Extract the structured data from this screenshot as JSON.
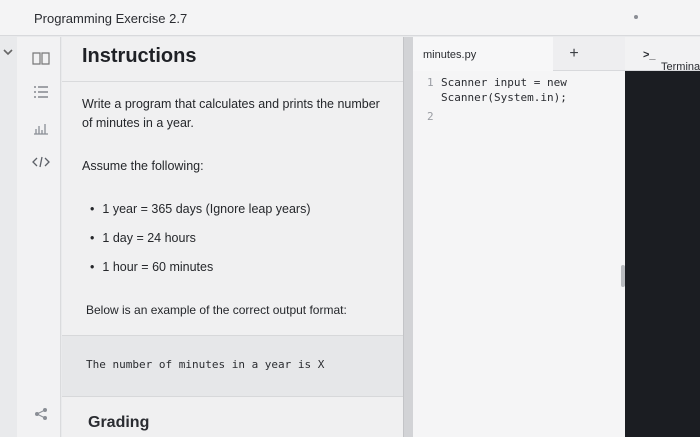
{
  "window": {
    "title": "Programming Exercise 2.7"
  },
  "rail": {
    "icons": [
      "book-icon",
      "list-icon",
      "chart-icon",
      "code-icon",
      "share-icon"
    ]
  },
  "instructions": {
    "heading": "Instructions",
    "paragraph1": "Write a program that calculates and prints the number of minutes in a year.",
    "paragraph2": "Assume the following:",
    "bullets": [
      "1 year = 365 days (Ignore leap years)",
      "1 day = 24 hours",
      "1 hour = 60 minutes"
    ],
    "paragraph3": "Below is an example of the correct output format:",
    "example_output": "The number of minutes in a year is X",
    "grading": "Grading"
  },
  "editor": {
    "tab_label": "minutes.py",
    "add_tab_symbol": "+",
    "line_numbers": [
      "1",
      "2"
    ],
    "code": "Scanner input = new\nScanner(System.in);"
  },
  "terminal": {
    "prompt_symbol": ">_",
    "tab_label": "Terminal"
  }
}
